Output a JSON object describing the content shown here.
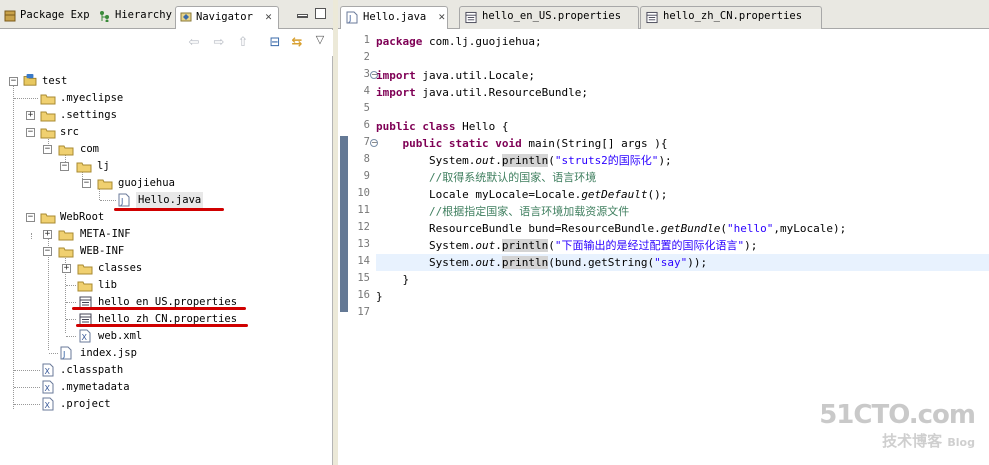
{
  "left_panel": {
    "tabs": [
      {
        "label": "Package Exp",
        "icon": "package-explorer-icon"
      },
      {
        "label": "Hierarchy",
        "icon": "hierarchy-icon"
      },
      {
        "label": "Navigator",
        "icon": "navigator-icon",
        "close": "✕"
      }
    ],
    "toolbar": {
      "back": "⇦",
      "forward": "⇨",
      "up": "⇧",
      "collapse": "⊟",
      "link": "⇆",
      "menu": "▽"
    }
  },
  "tree": [
    {
      "label": "test",
      "icon": "project-icon",
      "expander": "−"
    },
    {
      "label": ".myeclipse",
      "icon": "folder-icon"
    },
    {
      "label": ".settings",
      "icon": "folder-icon",
      "expander": "+"
    },
    {
      "label": "src",
      "icon": "folder-icon",
      "expander": "−"
    },
    {
      "label": "com",
      "icon": "folder-icon",
      "expander": "−"
    },
    {
      "label": "lj",
      "icon": "folder-icon",
      "expander": "−"
    },
    {
      "label": "guojiehua",
      "icon": "folder-icon",
      "expander": "−"
    },
    {
      "label": "Hello.java",
      "icon": "java-file-icon",
      "selected": true
    },
    {
      "label": "WebRoot",
      "icon": "folder-icon",
      "expander": "−"
    },
    {
      "label": "META-INF",
      "icon": "folder-icon",
      "expander": "+"
    },
    {
      "label": "WEB-INF",
      "icon": "folder-icon",
      "expander": "−"
    },
    {
      "label": "classes",
      "icon": "folder-icon",
      "expander": "+"
    },
    {
      "label": "lib",
      "icon": "folder-icon"
    },
    {
      "label": "hello_en_US.properties",
      "icon": "properties-file-icon"
    },
    {
      "label": "hello_zh_CN.properties",
      "icon": "properties-file-icon"
    },
    {
      "label": "web.xml",
      "icon": "xml-file-icon"
    },
    {
      "label": "index.jsp",
      "icon": "jsp-file-icon"
    },
    {
      "label": ".classpath",
      "icon": "xml-file-icon"
    },
    {
      "label": ".mymetadata",
      "icon": "xml-file-icon"
    },
    {
      "label": ".project",
      "icon": "xml-file-icon"
    }
  ],
  "editor": {
    "tabs": [
      {
        "label": "Hello.java",
        "icon": "java-file-icon",
        "close": "✕"
      },
      {
        "label": "hello_en_US.properties",
        "icon": "properties-file-icon"
      },
      {
        "label": "hello_zh_CN.properties",
        "icon": "properties-file-icon"
      }
    ],
    "line_numbers": [
      "1",
      "2",
      "3",
      "4",
      "5",
      "6",
      "7",
      "8",
      "9",
      "10",
      "11",
      "12",
      "13",
      "14",
      "15",
      "16",
      "17"
    ],
    "current_line": 14,
    "code": [
      "package com.lj.guojiehua;",
      "",
      "import java.util.Locale;",
      "import java.util.ResourceBundle;",
      "",
      "public class Hello {",
      "    public static void main(String[] args ){",
      "        System.out.println(\"struts2的国际化\");",
      "        //取得系统默认的国家、语言环境",
      "        Locale myLocale=Locale.getDefault();",
      "        //根据指定国家、语言环境加载资源文件",
      "        ResourceBundle bund=ResourceBundle.getBundle(\"hello\",myLocale);",
      "        System.out.println(\"下面输出的是经过配置的国际化语言\");",
      "        System.out.println(bund.getString(\"say\"));",
      "    }",
      "}",
      ""
    ]
  },
  "watermark": {
    "line1": "51CTO.com",
    "line2": "技术博客",
    "line3": "Blog"
  },
  "colors": {
    "keyword": "#7f0055",
    "string": "#2a00ff",
    "comment": "#3f7f5f",
    "annotation_red": "#d00000",
    "current_line": "#e8f2fe"
  }
}
